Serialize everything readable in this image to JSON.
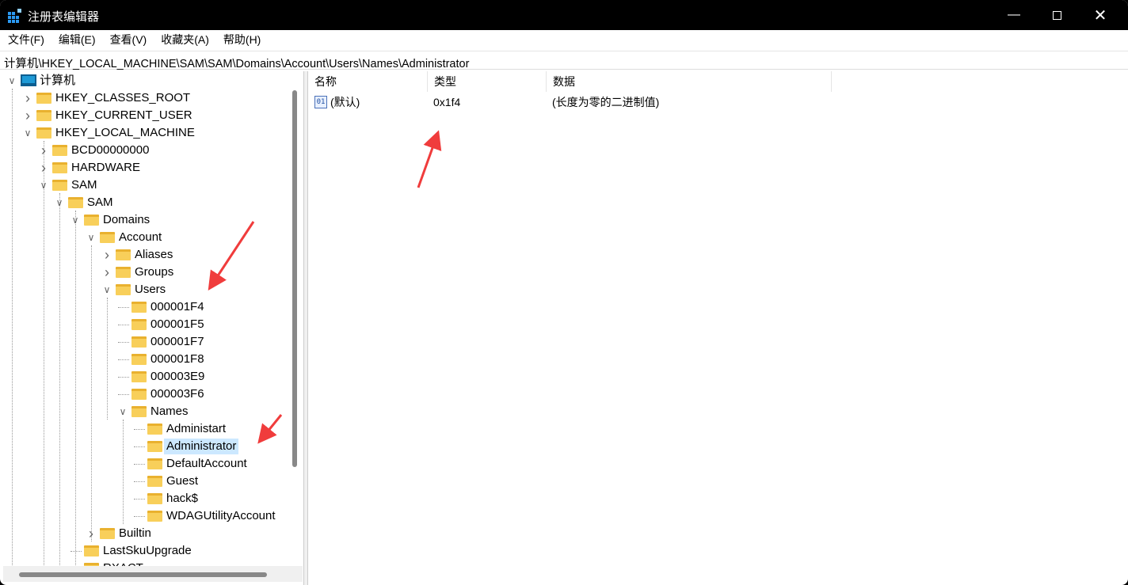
{
  "window": {
    "title": "注册表编辑器",
    "controls": [
      "minimize",
      "maximize",
      "close"
    ]
  },
  "menu": [
    "文件(F)",
    "编辑(E)",
    "查看(V)",
    "收藏夹(A)",
    "帮助(H)"
  ],
  "address": "计算机\\HKEY_LOCAL_MACHINE\\SAM\\SAM\\Domains\\Account\\Users\\Names\\Administrator",
  "tree": [
    {
      "level": 0,
      "label": "计算机",
      "exp": "open",
      "icon": "computer"
    },
    {
      "level": 1,
      "label": "HKEY_CLASSES_ROOT",
      "exp": "closed"
    },
    {
      "level": 1,
      "label": "HKEY_CURRENT_USER",
      "exp": "closed"
    },
    {
      "level": 1,
      "label": "HKEY_LOCAL_MACHINE",
      "exp": "open"
    },
    {
      "level": 2,
      "label": "BCD00000000",
      "exp": "closed"
    },
    {
      "level": 2,
      "label": "HARDWARE",
      "exp": "closed"
    },
    {
      "level": 2,
      "label": "SAM",
      "exp": "open"
    },
    {
      "level": 3,
      "label": "SAM",
      "exp": "open"
    },
    {
      "level": 4,
      "label": "Domains",
      "exp": "open"
    },
    {
      "level": 5,
      "label": "Account",
      "exp": "open"
    },
    {
      "level": 6,
      "label": "Aliases",
      "exp": "closed"
    },
    {
      "level": 6,
      "label": "Groups",
      "exp": "closed"
    },
    {
      "level": 6,
      "label": "Users",
      "exp": "open"
    },
    {
      "level": 7,
      "label": "000001F4",
      "exp": "none"
    },
    {
      "level": 7,
      "label": "000001F5",
      "exp": "none"
    },
    {
      "level": 7,
      "label": "000001F7",
      "exp": "none"
    },
    {
      "level": 7,
      "label": "000001F8",
      "exp": "none"
    },
    {
      "level": 7,
      "label": "000003E9",
      "exp": "none"
    },
    {
      "level": 7,
      "label": "000003F6",
      "exp": "none"
    },
    {
      "level": 7,
      "label": "Names",
      "exp": "open"
    },
    {
      "level": 8,
      "label": "Administart",
      "exp": "none"
    },
    {
      "level": 8,
      "label": "Administrator",
      "exp": "none",
      "selected": true
    },
    {
      "level": 8,
      "label": "DefaultAccount",
      "exp": "none"
    },
    {
      "level": 8,
      "label": "Guest",
      "exp": "none"
    },
    {
      "level": 8,
      "label": "hack$",
      "exp": "none"
    },
    {
      "level": 8,
      "label": "WDAGUtilityAccount",
      "exp": "none"
    },
    {
      "level": 5,
      "label": "Builtin",
      "exp": "closed"
    },
    {
      "level": 4,
      "label": "LastSkuUpgrade",
      "exp": "none"
    },
    {
      "level": 4,
      "label": "RXACT",
      "exp": "none"
    }
  ],
  "list": {
    "columns": [
      "名称",
      "类型",
      "数据"
    ],
    "rows": [
      {
        "name": "(默认)",
        "type": "0x1f4",
        "data": "(长度为零的二进制值)",
        "icon": "binary-value"
      }
    ]
  },
  "colors": {
    "selection": "#cce8ff",
    "folder": "#f8cf5a",
    "annotation_arrow": "#f03c3c"
  }
}
